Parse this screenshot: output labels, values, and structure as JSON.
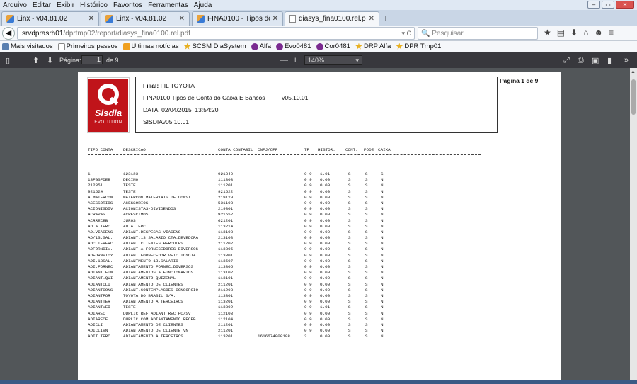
{
  "menu": [
    "Arquivo",
    "Editar",
    "Exibir",
    "Histórico",
    "Favoritos",
    "Ferramentas",
    "Ajuda"
  ],
  "tabs": [
    {
      "label": "Linx - v04.81.02",
      "active": false
    },
    {
      "label": "Linx - v04.81.02",
      "active": false
    },
    {
      "label": "FINA0100 - Tipos de Conta...",
      "active": false
    },
    {
      "label": "diasys_fina0100.rel.pdf",
      "active": true
    }
  ],
  "newtab": "+",
  "url": {
    "host": "srvdprasrh01",
    "path": "/dprtmp02/report/diasys_fina0100.rel.pdf",
    "right": "▾ C"
  },
  "search": {
    "placeholder": "Pesquisar"
  },
  "bookmarks": [
    {
      "label": "Mais visitados",
      "icon": "gear"
    },
    {
      "label": "Primeiros passos",
      "icon": "page"
    },
    {
      "label": "Últimas notícias",
      "icon": "rss"
    },
    {
      "label": "SCSM DiaSystem",
      "icon": "star"
    },
    {
      "label": "Alfa",
      "icon": "q"
    },
    {
      "label": "Evo0481",
      "icon": "q"
    },
    {
      "label": "Cor0481",
      "icon": "q"
    },
    {
      "label": "DRP Alfa",
      "icon": "star"
    },
    {
      "label": "DPR Tmp01",
      "icon": "star"
    }
  ],
  "pdf": {
    "page_label": "Página:",
    "page_value": "1",
    "page_total": "de 9",
    "zoom": "140%"
  },
  "logo": {
    "name": "Sisdia",
    "tagline": "EVOLUTION"
  },
  "report": {
    "filial_label": "Filial:",
    "filial": "FIL TOYOTA",
    "title": "FINA0100 Tipos de Conta do Caixa E Bancos",
    "version": "v05.10.01",
    "date": "DATA: 02/04/2015  13:54:20",
    "system": "SISDIAv05.10.01",
    "page": "Página 1 de  9",
    "columns": [
      "TIPO CONTA",
      "DESCRICAO",
      "CONTA CONTABIL",
      "CNPJ/CPF",
      "TP",
      "HISTOR.",
      "CONT.",
      "PODE",
      "CAIXA"
    ],
    "rows": [
      [
        "1",
        "123123",
        "921840",
        "",
        "0 9",
        "1.01",
        "S",
        "S",
        "S"
      ],
      [
        "13FGSFDEB",
        "DECIMO",
        "111303",
        "",
        "0 9",
        "0.00",
        "S",
        "S",
        "N"
      ],
      [
        "212351",
        "TESTE",
        "111201",
        "",
        "0 9",
        "0.00",
        "S",
        "S",
        "N"
      ],
      [
        "921524",
        "TESTE",
        "921522",
        "",
        "0 9",
        "0.00",
        "S",
        "S",
        "N"
      ],
      [
        "A.MATERCON",
        "MATERCON MATERIAIS DE CONST.",
        "219129",
        "",
        "0 9",
        "0.00",
        "S",
        "S",
        "N"
      ],
      [
        "ACESSORIOS",
        "ACESSORIOS",
        "531103",
        "",
        "0 9",
        "0.00",
        "S",
        "S",
        "N"
      ],
      [
        "ACIONISDIV",
        "ACIONISTAS-DIVIDENDOS",
        "219301",
        "",
        "0 9",
        "0.00",
        "S",
        "S",
        "N"
      ],
      [
        "ACRAPAG",
        "ACRESCIMOS",
        "921552",
        "",
        "0 9",
        "0.00",
        "S",
        "S",
        "N"
      ],
      [
        "ACRRECEB",
        "JUROS",
        "621201",
        "",
        "0 9",
        "0.00",
        "S",
        "S",
        "N"
      ],
      [
        "AD.A TERC.",
        "AD.A TERC.",
        "113214",
        "",
        "0 9",
        "0.00",
        "S",
        "S",
        "N"
      ],
      [
        "AD.VIAGENS",
        "ADIANT.DESPESAS VIAGENS",
        "113103",
        "",
        "0 9",
        "0.00",
        "S",
        "S",
        "N"
      ],
      [
        "AD/13.SAL.",
        "ADIANT.13.SALARIO CTA.DEVEDORA",
        "213108",
        "",
        "0 9",
        "0.00",
        "S",
        "S",
        "N"
      ],
      [
        "ADCLIEHERC",
        "ADIANT.CLIENTES HERCULES",
        "211202",
        "",
        "0 9",
        "0.00",
        "S",
        "S",
        "N"
      ],
      [
        "ADFORNDIV.",
        "ADIANT A FORNECEDORES DIVERSOS",
        "113305",
        "",
        "0 9",
        "0.00",
        "S",
        "S",
        "N"
      ],
      [
        "ADFORNVTOY",
        "ADIANT FORNECEDOR VEIC TOYOTA",
        "113301",
        "",
        "0 9",
        "0.00",
        "S",
        "S",
        "N"
      ],
      [
        "ADI.13SAL.",
        "ADIANTMENTO 13.SALARIO",
        "113507",
        "",
        "0 9",
        "0.00",
        "S",
        "S",
        "N"
      ],
      [
        "ADI.FORNEC",
        "ADIANTAMENTO FORNEC.DIVERSOS",
        "113305",
        "",
        "0 9",
        "0.00",
        "S",
        "S",
        "N"
      ],
      [
        "ADIANT.FUN",
        "ADIANTAMENTOS A FUNCIONARIOS",
        "113102",
        "",
        "0 9",
        "0.00",
        "S",
        "S",
        "N"
      ],
      [
        "ADIANT.QUI",
        "ADIANTAMENTO QUIZENAL",
        "113101",
        "",
        "0 9",
        "0.00",
        "S",
        "S",
        "N"
      ],
      [
        "ADIANTCLI",
        "ADIANTAMENTO DE CLIENTES",
        "211201",
        "",
        "0 9",
        "0.00",
        "S",
        "S",
        "N"
      ],
      [
        "ADIANTCONS",
        "ADIANT.CONTEMPLACOES CONSORCIO",
        "211203",
        "",
        "0 9",
        "0.00",
        "S",
        "S",
        "N"
      ],
      [
        "ADIANTFOR",
        "TOYOTA DO BRASIL S/A.",
        "113301",
        "",
        "0 9",
        "0.00",
        "S",
        "S",
        "N"
      ],
      [
        "ADIANTTER",
        "ADIANTAMENTO A TERCEIROS",
        "113201",
        "",
        "0 9",
        "0.00",
        "S",
        "S",
        "N"
      ],
      [
        "ADIANTVEI",
        "TESTE",
        "113302",
        "",
        "0 9",
        "1.01",
        "S",
        "S",
        "N"
      ],
      [
        "ADIAREC",
        "DUPLIC REF ADIANT REC PC/SV",
        "112103",
        "",
        "0 9",
        "0.00",
        "S",
        "S",
        "N"
      ],
      [
        "ADIARECE",
        "DUPLIC COM ADIANTAMENTO RECEB",
        "112104",
        "",
        "0 9",
        "0.00",
        "S",
        "S",
        "N"
      ],
      [
        "ADICLI",
        "ADIANTAMENTO DE CLIENTES",
        "211201",
        "",
        "0 9",
        "0.00",
        "S",
        "S",
        "N"
      ],
      [
        "ADICLIVN",
        "ADIANTAMENTO DE CLIENTE VN",
        "211201",
        "",
        "0 9",
        "0.00",
        "S",
        "S",
        "N"
      ],
      [
        "ADIT.TERC.",
        "ADIANTAMENTO A TERCEIROS",
        "113201",
        "1616674000188",
        "2",
        "0.00",
        "S",
        "S",
        "N"
      ]
    ]
  }
}
